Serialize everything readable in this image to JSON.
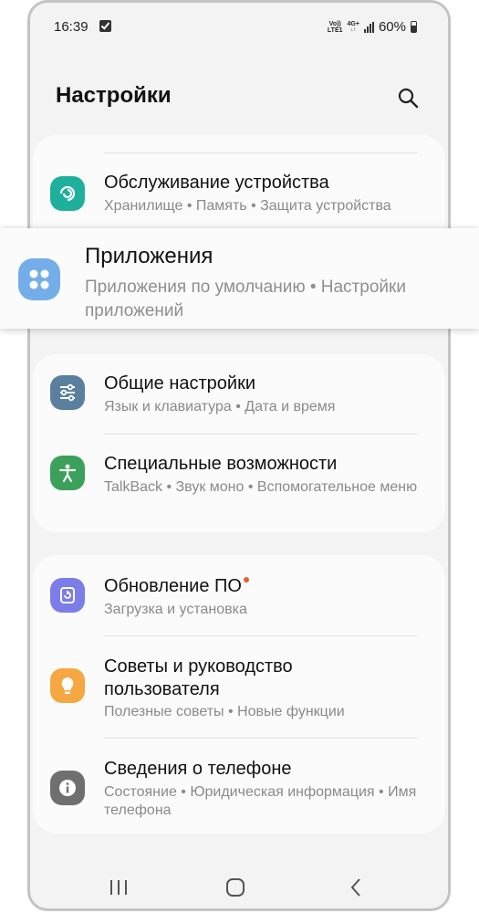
{
  "status_bar": {
    "time": "16:39",
    "network_top": "Vo))",
    "network_bottom": "LTE1",
    "net_type": "4G+",
    "battery": "60%"
  },
  "header": {
    "title": "Настройки"
  },
  "cards": {
    "maintenance": {
      "title": "Обслуживание устройства",
      "subtitle": "Хранилище  •  Память  •  Защита устройства"
    },
    "general": {
      "title": "Общие настройки",
      "subtitle": "Язык и клавиатура  •  Дата и время"
    },
    "accessibility": {
      "title": "Специальные возможности",
      "subtitle": "TalkBack  •  Звук моно  •  Вспомогательное меню"
    },
    "update": {
      "title": "Обновление ПО",
      "subtitle": "Загрузка и установка"
    },
    "tips": {
      "title": "Советы и руководство пользователя",
      "subtitle": "Полезные советы  •  Новые функции"
    },
    "about": {
      "title": "Сведения о телефоне",
      "subtitle": "Состояние  •  Юридическая информация  •  Имя телефона"
    }
  },
  "highlight": {
    "title": "Приложения",
    "subtitle": "Приложения по умолчанию  •  Настройки приложений"
  },
  "colors": {
    "maintenance": "#1fb09b",
    "apps": "#74aee8",
    "general": "#5b7f9e",
    "accessibility": "#3aa05a",
    "update": "#7b7de9",
    "tips": "#f5a742",
    "about": "#6f6f6f",
    "badge": "#e8612a"
  },
  "icons": {
    "search": "search-icon",
    "maintenance": "device-care-icon",
    "apps": "apps-grid-icon",
    "general": "sliders-icon",
    "accessibility": "accessibility-person-icon",
    "update": "software-update-icon",
    "tips": "lightbulb-icon",
    "about": "info-icon"
  }
}
